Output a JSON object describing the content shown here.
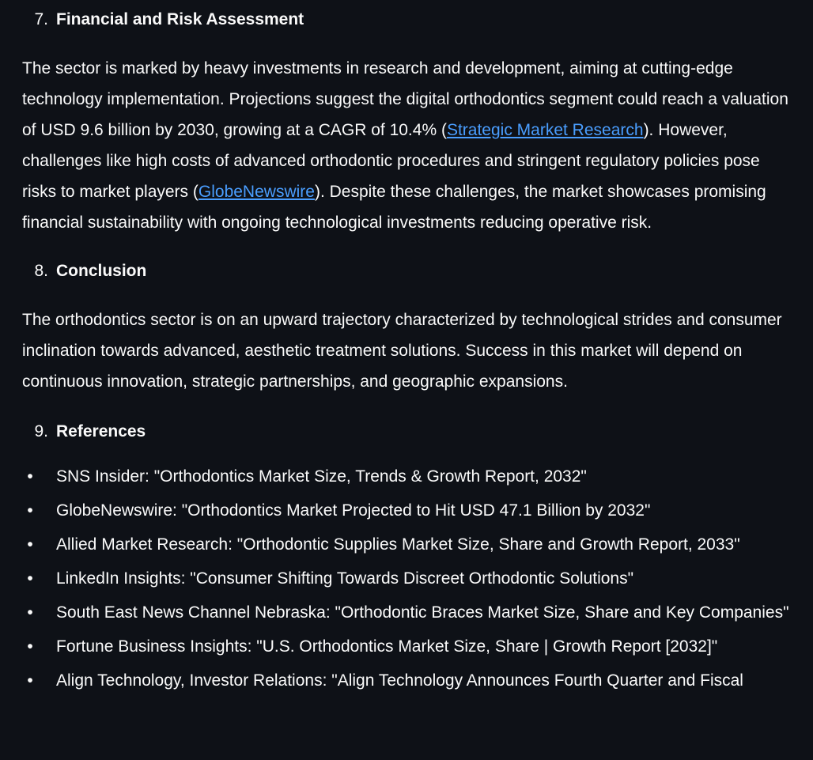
{
  "section7": {
    "number": "7.",
    "title": "Financial and Risk Assessment",
    "para_1": "The sector is marked by heavy investments in research and development, aiming at cutting-edge technology implementation. Projections suggest the digital orthodontics segment could reach a valuation of USD 9.6 billion by 2030, growing at a CAGR of 10.4% (",
    "link_1": "Strategic Market Research",
    "para_2": "). However, challenges like high costs of advanced orthodontic procedures and stringent regulatory policies pose risks to market players (",
    "link_2": "GlobeNewswire",
    "para_3": "). Despite these challenges, the market showcases promising financial sustainability with ongoing technological investments reducing operative risk."
  },
  "section8": {
    "number": "8.",
    "title": "Conclusion",
    "para": "The orthodontics sector is on an upward trajectory characterized by technological strides and consumer inclination towards advanced, aesthetic treatment solutions. Success in this market will depend on continuous innovation, strategic partnerships, and geographic expansions."
  },
  "section9": {
    "number": "9.",
    "title": "References",
    "bullet": "•",
    "references": [
      "SNS Insider: \"Orthodontics Market Size, Trends & Growth Report, 2032\"",
      "GlobeNewswire: \"Orthodontics Market Projected to Hit USD 47.1 Billion by 2032\"",
      "Allied Market Research: \"Orthodontic Supplies Market Size, Share and Growth Report, 2033\"",
      "LinkedIn Insights: \"Consumer Shifting Towards Discreet Orthodontic Solutions\"",
      "South East News Channel Nebraska: \"Orthodontic Braces Market Size, Share and Key Companies\"",
      "Fortune Business Insights: \"U.S. Orthodontics Market Size, Share | Growth Report [2032]\"",
      "Align Technology, Investor Relations: \"Align Technology Announces Fourth Quarter and Fiscal"
    ]
  },
  "colors": {
    "background": "#0e1117",
    "text": "#fafafa",
    "link": "#4a9eff"
  }
}
